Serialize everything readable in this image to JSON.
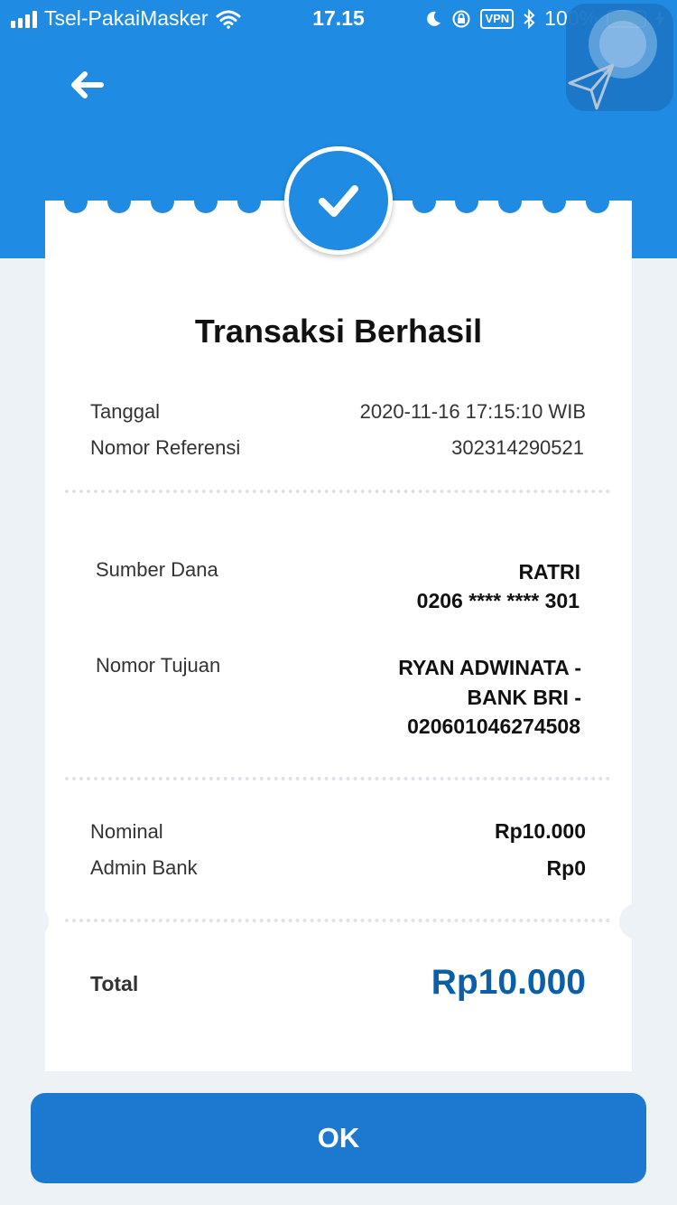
{
  "status_bar": {
    "carrier": "Tsel-PakaiMasker",
    "time": "17.15",
    "vpn": "VPN",
    "battery": "100%"
  },
  "header": {
    "back_icon": "arrow-left-icon"
  },
  "overlay_app": {
    "icon": "paper-plane-icon"
  },
  "receipt": {
    "status_icon": "checkmark-icon",
    "title": "Transaksi Berhasil",
    "date_label": "Tanggal",
    "date_value": "2020-11-16 17:15:10 WIB",
    "ref_label": "Nomor Referensi",
    "ref_value": "302314290521",
    "source_label": "Sumber Dana",
    "source_name": "RATRI",
    "source_account": "0206 **** **** 301",
    "dest_label": "Nomor Tujuan",
    "dest_line1": "RYAN ADWINATA -",
    "dest_line2": "BANK BRI -",
    "dest_line3": "020601046274508",
    "nominal_label": "Nominal",
    "nominal_value": "Rp10.000",
    "admin_label": "Admin Bank",
    "admin_value": "Rp0",
    "total_label": "Total",
    "total_value": "Rp10.000"
  },
  "actions": {
    "ok_label": "OK"
  },
  "colors": {
    "primary": "#1f8be3",
    "button": "#1c79cf",
    "total_text": "#0b5ea8",
    "background": "#edf2f6"
  }
}
